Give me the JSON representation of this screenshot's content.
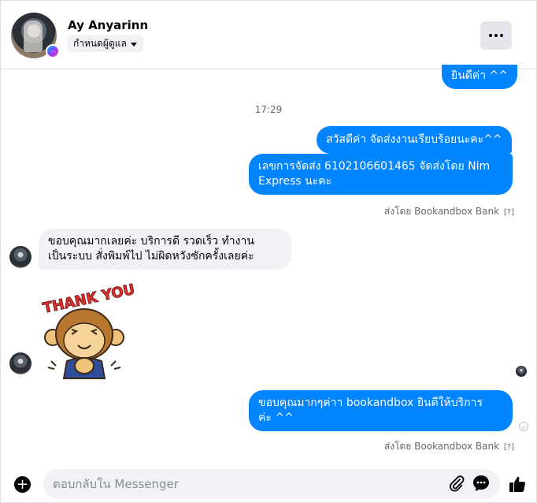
{
  "header": {
    "contact_name": "Ay Anyarinn",
    "admin_label": "กำหนดผู้ดูแล"
  },
  "messages": {
    "prev_out": "ยินดีค่า ^^",
    "timestamp": "17:29",
    "out1": "สวัสดีค่า จัดส่งงานเรียบร้อยนะคะ^^",
    "out2_line1": "เลขการจัดส่ง 6102106601465 จัดส่งโดย Nim",
    "out2_line2": "Express นะคะ",
    "sent_by_1": "ส่งโดย Bookandbox Bank",
    "sent_by_help": "[?]",
    "in1_line1": "ขอบคุณมากเลยค่ะ บริการดี รวดเร็ว ทำงาน",
    "in1_line2": "เป็นระบบ สั่งพิมพ์ไป ไม่ผิดหวังซักครั้งเลยค่ะ",
    "sticker_text": "THANK YOU",
    "out3_line1": "ขอบคุณมากๆค่าา bookandbox ยินดีให้บริการ",
    "out3_line2": "ค่ะ ^^",
    "sent_by_2": "ส่งโดย Bookandbox Bank"
  },
  "composer": {
    "placeholder": "ตอบกลับใน Messenger"
  },
  "icons": {
    "more": "more-horizontal-icon",
    "add": "plus-circle-icon",
    "attach": "paperclip-icon",
    "emoji": "chat-bubble-icon",
    "like": "thumbs-up-icon",
    "messenger": "messenger-icon"
  },
  "colors": {
    "outgoing_bubble": "#0084ff",
    "incoming_bubble": "#f0f2f5",
    "meta_text": "#65676b"
  }
}
